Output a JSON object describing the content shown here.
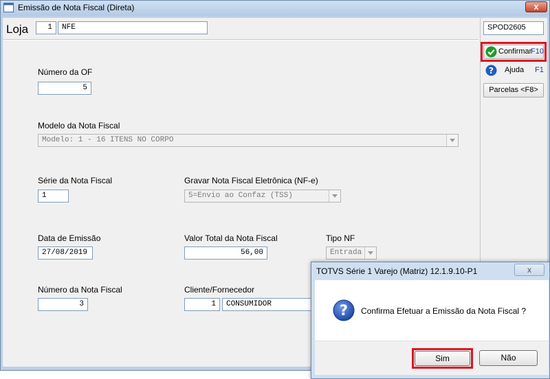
{
  "window": {
    "title": "Emissão de Nota Fiscal (Direta)",
    "close_glyph": "x"
  },
  "header": {
    "loja_label": "Loja",
    "loja_code": "1",
    "loja_name": "NFE",
    "station": "SPOD2605"
  },
  "form": {
    "numero_of_label": "Número da OF",
    "numero_of_value": "5",
    "modelo_label": "Modelo da Nota Fiscal",
    "modelo_value": "Modelo: 1 - 16 ITENS NO CORPO",
    "serie_label": "Série da Nota Fiscal",
    "serie_value": "1",
    "gravar_label": "Gravar Nota Fiscal Eletrônica (NF-e)",
    "gravar_value": "5=Envio ao Confaz (TSS)",
    "data_label": "Data de Emissão",
    "data_value": "27/08/2019",
    "valor_label": "Valor Total da Nota Fiscal",
    "valor_value": "56,00",
    "tipo_label": "Tipo NF",
    "tipo_value": "Entrada",
    "numero_nf_label": "Número da Nota Fiscal",
    "numero_nf_value": "3",
    "cliente_label": "Cliente/Fornecedor",
    "cliente_code": "1",
    "cliente_name": "CONSUMIDOR"
  },
  "side_buttons": {
    "confirmar": "Confirmar",
    "confirmar_key": "F10",
    "ajuda": "Ajuda",
    "ajuda_key": "F1",
    "parcelas": "Parcelas <F8>"
  },
  "dialog": {
    "title": "TOTVS Série 1 Varejo (Matriz) 12.1.9.10-P1",
    "message": "Confirma Efetuar a Emissão da Nota Fiscal ?",
    "yes": "Sim",
    "no": "Não",
    "close_glyph": "x"
  },
  "colors": {
    "highlight": "#e0121f",
    "confirm_icon": "#1f9a2a",
    "help_icon": "#1f5fbf"
  }
}
